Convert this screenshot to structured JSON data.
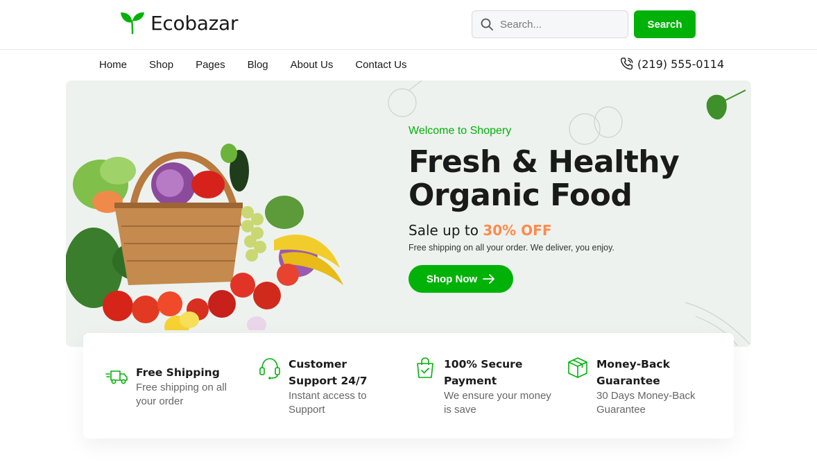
{
  "brand": {
    "name": "Ecobazar",
    "accent_color": "#00b207",
    "logo_icon": "leaf-sprout-icon"
  },
  "search": {
    "placeholder": "Search...",
    "button_label": "Search"
  },
  "nav": {
    "items": [
      {
        "label": "Home"
      },
      {
        "label": "Shop"
      },
      {
        "label": "Pages"
      },
      {
        "label": "Blog"
      },
      {
        "label": "About Us"
      },
      {
        "label": "Contact Us"
      }
    ],
    "phone": "(219) 555-0114"
  },
  "hero": {
    "welcome": "Welcome to Shopery",
    "title_line1": "Fresh & Healthy",
    "title_line2": "Organic Food",
    "sale_prefix": "Sale up to",
    "sale_value": "30% OFF",
    "sale_color": "#ff8a4c",
    "description": "Free shipping on all your order. We deliver, you enjoy.",
    "cta_label": "Shop Now"
  },
  "features": [
    {
      "icon": "truck-icon",
      "title": "Free Shipping",
      "desc": "Free shipping on all your order"
    },
    {
      "icon": "headphones-icon",
      "title": "Customer Support 24/7",
      "desc": "Instant access to Support"
    },
    {
      "icon": "shopping-bag-check-icon",
      "title": "100% Secure Payment",
      "desc": "We ensure your money is save"
    },
    {
      "icon": "package-box-icon",
      "title": "Money-Back Guarantee",
      "desc": "30 Days Money-Back Guarantee"
    }
  ]
}
